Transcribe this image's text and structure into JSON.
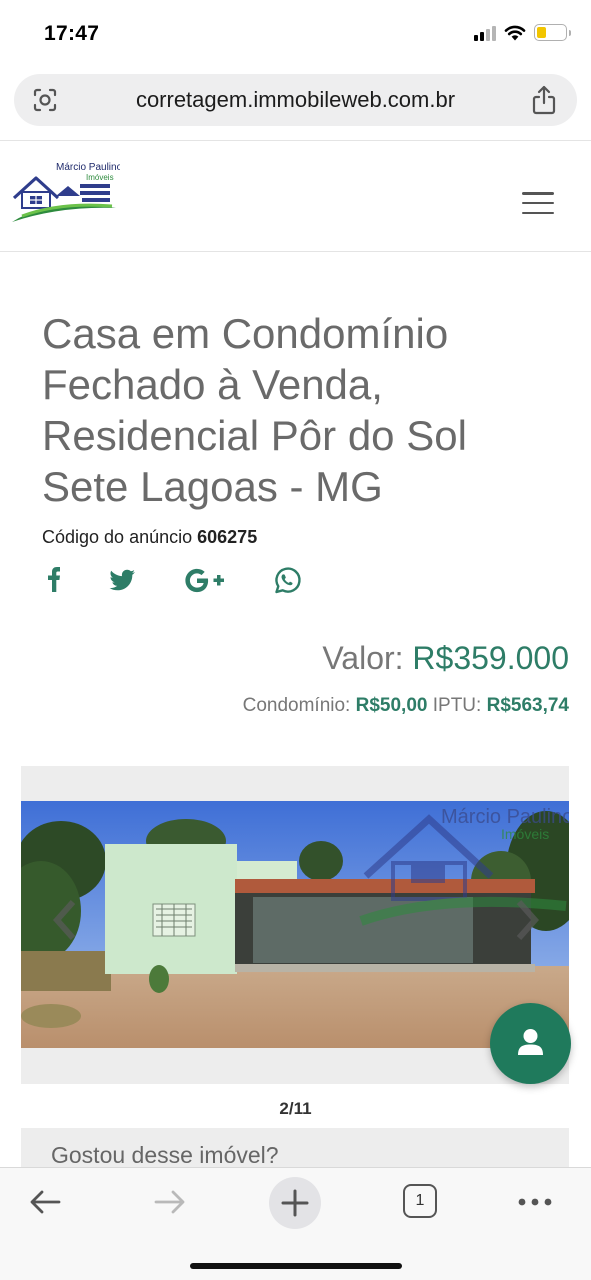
{
  "status_bar": {
    "time": "17:47",
    "icons": [
      "signal-icon",
      "wifi-icon",
      "battery-icon"
    ],
    "battery_level": 0.35,
    "battery_color": "#f2c500"
  },
  "browser": {
    "url": "corretagem.immobileweb.com.br",
    "tabs_count": "1"
  },
  "site": {
    "logo_text_line1": "Márcio Paulino",
    "logo_text_line2": "Imóveis",
    "menu_icon": "hamburger-icon"
  },
  "listing": {
    "title": "Casa em Condomínio Fechado à Venda, Residencial Pôr do Sol Sete Lagoas - MG",
    "code_label": "Código do anúncio",
    "code": "606275",
    "share_icons": [
      "facebook-icon",
      "twitter-icon",
      "google-plus-icon",
      "whatsapp-icon"
    ],
    "price_label": "Valor:",
    "price": "R$359.000",
    "condo_label": "Condomínio:",
    "condo": "R$50,00",
    "iptu_label": "IPTU:",
    "iptu": "R$563,74",
    "accent_color": "#2e7d67"
  },
  "gallery": {
    "watermark_line1": "Márcio Paulino",
    "watermark_line2": "Imóveis",
    "counter": "2/11"
  },
  "interest": {
    "text": "Gostou desse imóvel?"
  },
  "bottom_nav": [
    "back-icon",
    "forward-icon",
    "new-tab-icon",
    "tabs-icon",
    "more-icon"
  ]
}
